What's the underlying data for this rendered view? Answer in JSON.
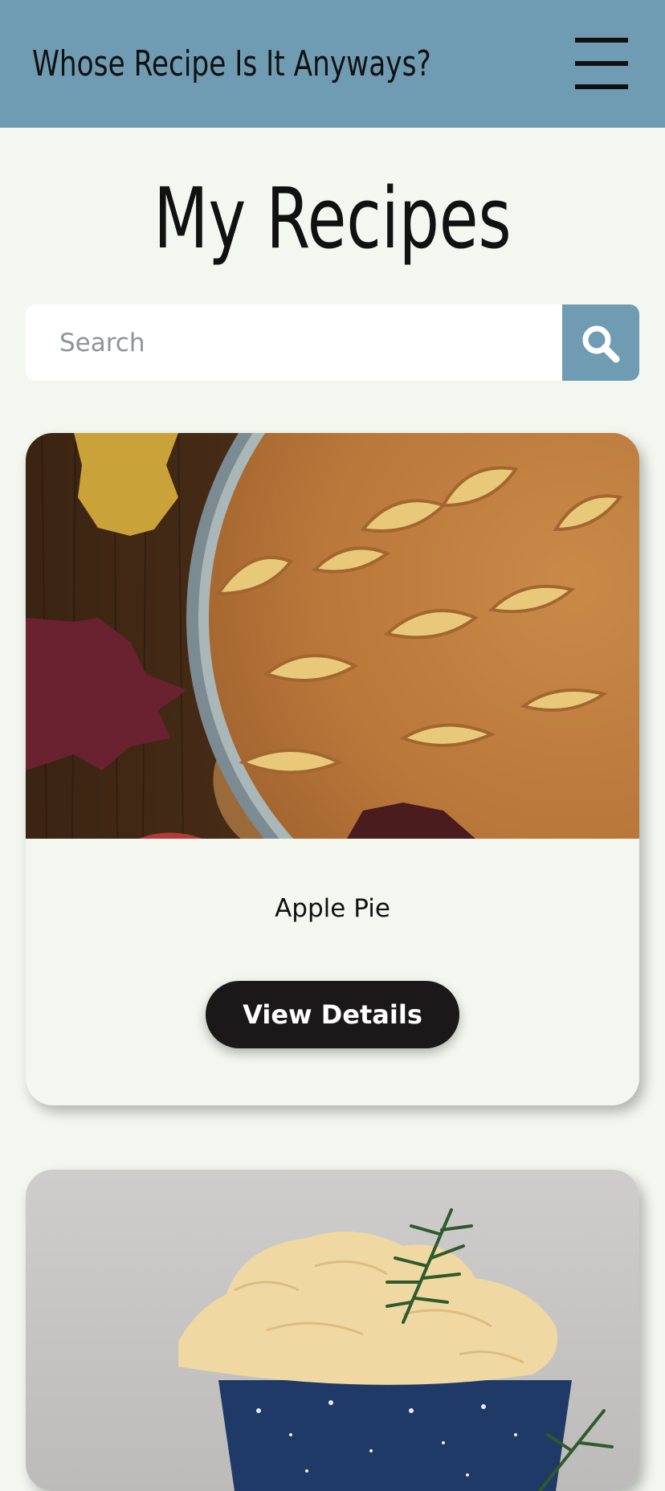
{
  "header": {
    "brand": "Whose Recipe Is It Anyways?",
    "menu_icon": "hamburger-menu-icon",
    "background_color": "#6f9cb3"
  },
  "page": {
    "title": "My Recipes",
    "background_color": "#f4f7f0"
  },
  "search": {
    "placeholder": "Search",
    "value": "",
    "button_icon": "search-icon",
    "accent_color": "#6f9cb3"
  },
  "recipes": [
    {
      "name": "Apple Pie",
      "image_description": "apple pie in glass dish on wooden table",
      "button_label": "View Details"
    },
    {
      "image_description": "scoop of ice cream with rosemary in blue speckled enamel cup"
    }
  ],
  "colors": {
    "button_dark": "#1a1818",
    "button_text": "#ffffff"
  }
}
